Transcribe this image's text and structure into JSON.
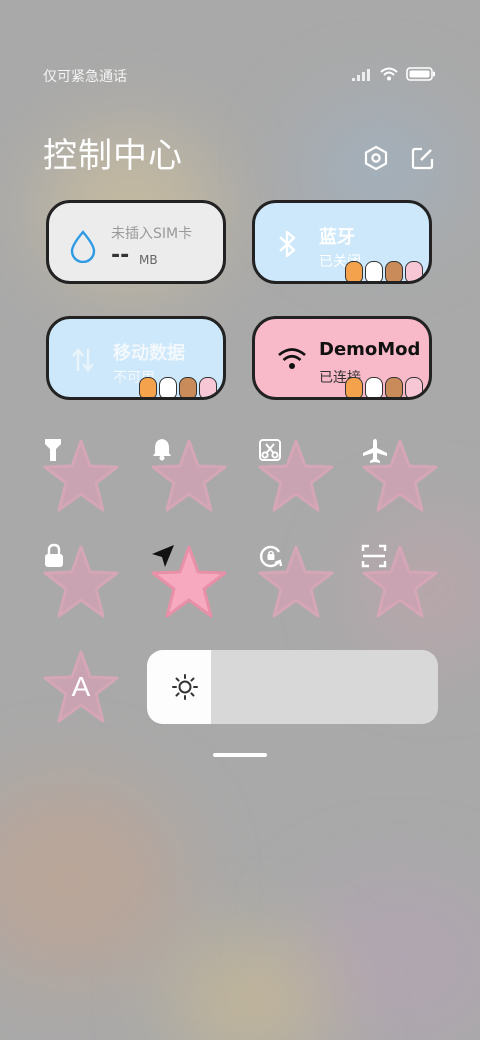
{
  "status": {
    "carrier": "仅可紧急通话",
    "icons": [
      "signal-icon",
      "wifi-icon",
      "battery-icon"
    ]
  },
  "header": {
    "title": "控制中心",
    "settings_icon": "settings-icon",
    "edit_icon": "edit-icon"
  },
  "tiles": {
    "sim": {
      "title": "未插入SIM卡",
      "value": "--",
      "unit": "MB",
      "icon": "water-drop-icon"
    },
    "bluetooth": {
      "title": "蓝牙",
      "status": "已关闭",
      "icon": "bluetooth-icon"
    },
    "mobile_data": {
      "title": "移动数据",
      "status": "不可用",
      "icon": "mobile-data-icon"
    },
    "wifi": {
      "title": "DemoMod",
      "status": "已连接",
      "icon": "wifi-icon"
    }
  },
  "toggles": [
    {
      "icon": "flashlight-icon",
      "active": false
    },
    {
      "icon": "bell-icon",
      "active": false
    },
    {
      "icon": "screenshot-icon",
      "active": false
    },
    {
      "icon": "airplane-icon",
      "active": false
    },
    {
      "icon": "lock-icon",
      "active": false
    },
    {
      "icon": "location-icon",
      "active": true
    },
    {
      "icon": "auto-rotate-icon",
      "active": false
    },
    {
      "icon": "scanner-icon",
      "active": false
    },
    {
      "icon": "auto-brightness-icon",
      "active": false,
      "label": "A"
    }
  ],
  "brightness": {
    "level": 0.22,
    "icon": "sun-icon"
  },
  "colors": {
    "star_inactive": "#c9a3b2",
    "star_active": "#f7a9c0",
    "tile_sim": "#ececec",
    "tile_blue": "#cde8fa",
    "tile_pink": "#f8b9c8"
  }
}
